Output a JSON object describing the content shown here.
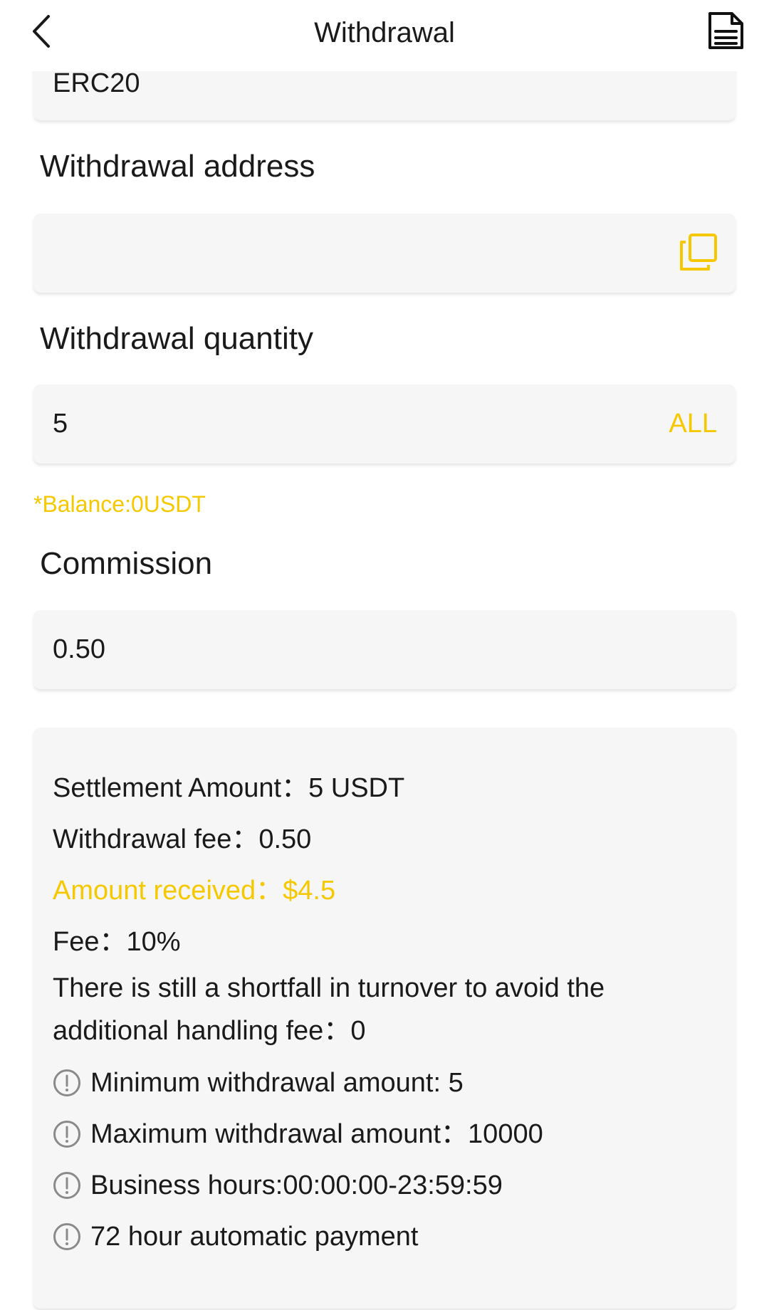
{
  "header": {
    "title": "Withdrawal"
  },
  "network": {
    "value": "ERC20"
  },
  "address": {
    "label": "Withdrawal address",
    "value": ""
  },
  "quantity": {
    "label": "Withdrawal quantity",
    "value": "5",
    "all_label": "ALL"
  },
  "balance": {
    "text": "*Balance:0USDT"
  },
  "commission": {
    "label": "Commission",
    "value": "0.50"
  },
  "summary": {
    "settlement": "Settlement Amount：5 USDT",
    "withdrawal_fee": "Withdrawal fee：0.50",
    "amount_received": "Amount received：$4.5",
    "fee": "Fee：10%",
    "shortfall": "There is still a shortfall in turnover to avoid the additional handling fee：0"
  },
  "notices": [
    "Minimum withdrawal amount: 5",
    "Maximum withdrawal amount：10000",
    "Business hours:00:00:00-23:59:59",
    "72 hour automatic payment"
  ],
  "colors": {
    "accent": "#f5c800",
    "card_bg": "#f6f6f6",
    "text": "#1a1a1a",
    "icon_gray": "#8a8a8a"
  },
  "icons": {
    "back": "back-arrow-icon",
    "records": "document-icon",
    "paste": "paste-icon",
    "notice": "exclamation-circle-icon"
  }
}
